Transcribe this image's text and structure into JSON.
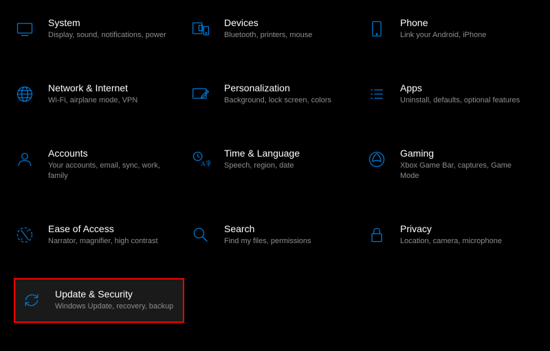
{
  "settings": [
    {
      "id": "system",
      "title": "System",
      "desc": "Display, sound, notifications, power"
    },
    {
      "id": "devices",
      "title": "Devices",
      "desc": "Bluetooth, printers, mouse"
    },
    {
      "id": "phone",
      "title": "Phone",
      "desc": "Link your Android, iPhone"
    },
    {
      "id": "network",
      "title": "Network & Internet",
      "desc": "Wi-Fi, airplane mode, VPN"
    },
    {
      "id": "personalization",
      "title": "Personalization",
      "desc": "Background, lock screen, colors"
    },
    {
      "id": "apps",
      "title": "Apps",
      "desc": "Uninstall, defaults, optional features"
    },
    {
      "id": "accounts",
      "title": "Accounts",
      "desc": "Your accounts, email, sync, work, family"
    },
    {
      "id": "time",
      "title": "Time & Language",
      "desc": "Speech, region, date"
    },
    {
      "id": "gaming",
      "title": "Gaming",
      "desc": "Xbox Game Bar, captures, Game Mode"
    },
    {
      "id": "ease",
      "title": "Ease of Access",
      "desc": "Narrator, magnifier, high contrast"
    },
    {
      "id": "search",
      "title": "Search",
      "desc": "Find my files, permissions"
    },
    {
      "id": "privacy",
      "title": "Privacy",
      "desc": "Location, camera, microphone"
    },
    {
      "id": "update",
      "title": "Update & Security",
      "desc": "Windows Update, recovery, backup"
    }
  ]
}
